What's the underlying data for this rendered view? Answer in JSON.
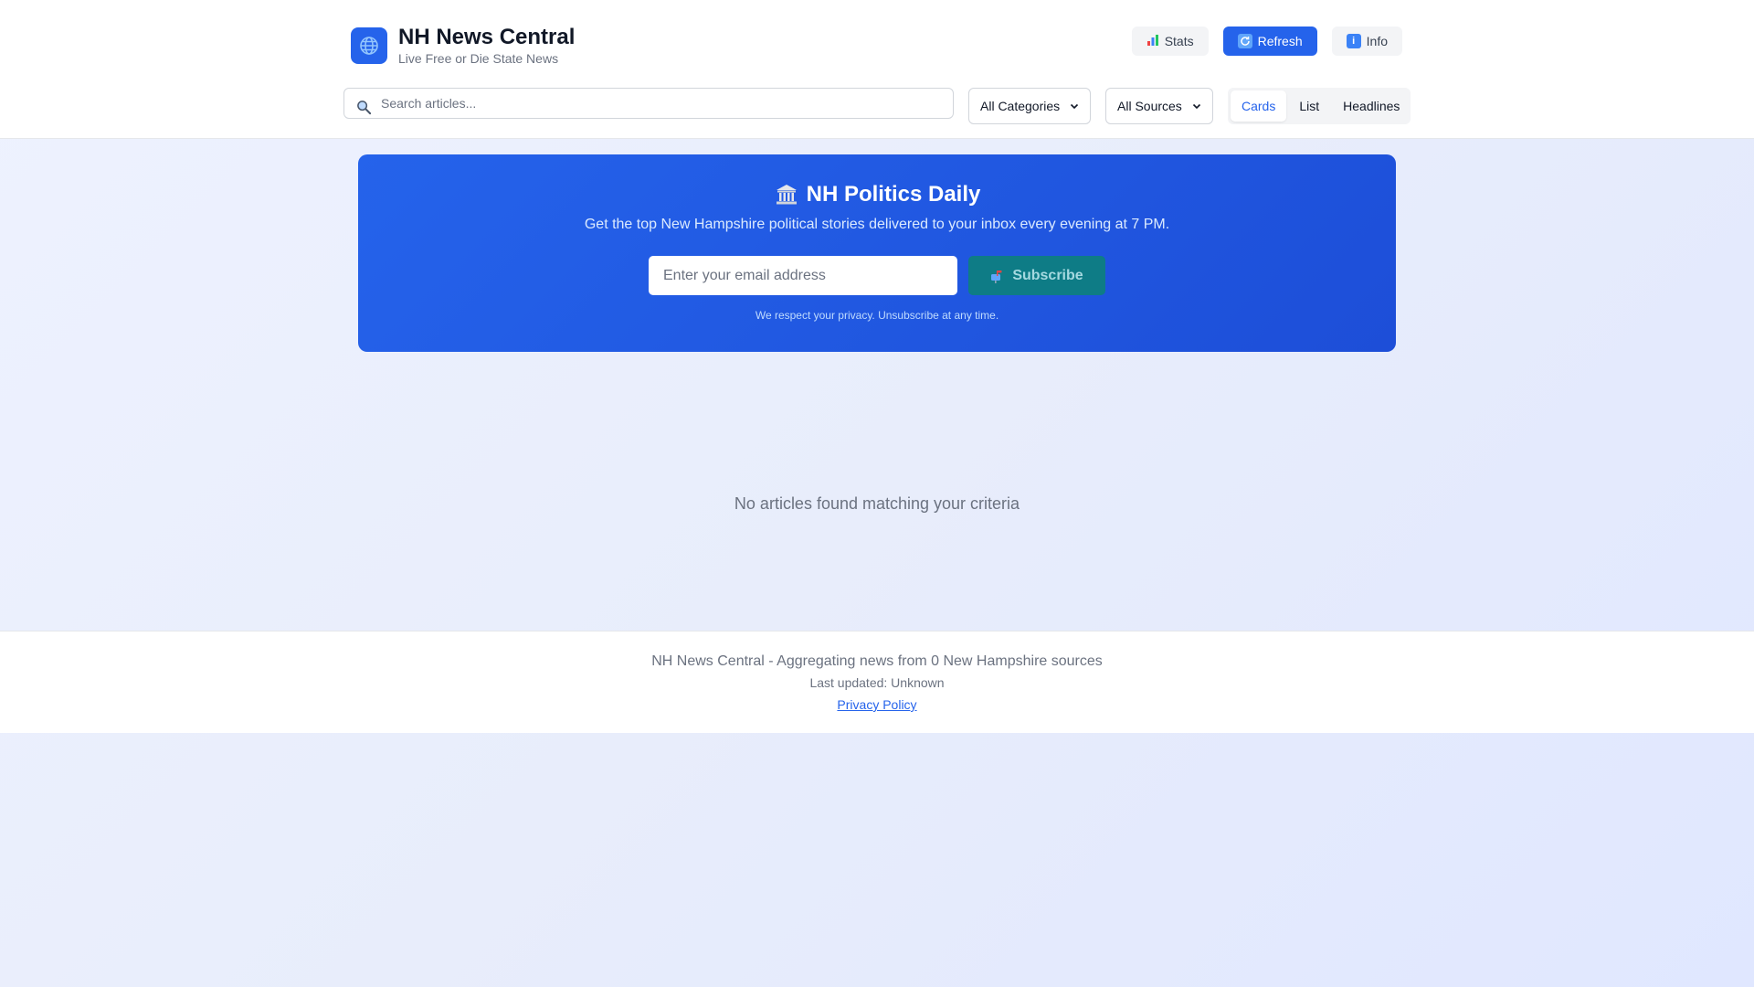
{
  "brand": {
    "title": "NH News Central",
    "tagline": "Live Free or Die State News",
    "logo_icon": "globe-icon"
  },
  "header_actions": [
    {
      "label": "Stats",
      "icon": "bar-chart-icon"
    },
    {
      "label": "Refresh",
      "icon": "refresh-icon"
    },
    {
      "label": "Info",
      "icon": "info-icon"
    }
  ],
  "search": {
    "placeholder": "Search articles...",
    "value": ""
  },
  "filters": {
    "category_selected": "All Categories",
    "source_selected": "All Sources"
  },
  "view_modes": [
    {
      "label": "Cards",
      "active": true
    },
    {
      "label": "List",
      "active": false
    },
    {
      "label": "Headlines",
      "active": false
    }
  ],
  "newsletter": {
    "title": "NH Politics Daily",
    "title_icon": "capitol-building-icon",
    "subtitle": "Get the top New Hampshire political stories delivered to your inbox every evening at 7 PM.",
    "email_placeholder": "Enter your email address",
    "subscribe_label": "Subscribe",
    "subscribe_icon": "mailbox-icon",
    "privacy_note": "We respect your privacy. Unsubscribe at any time."
  },
  "empty_state": {
    "message": "No articles found matching your criteria"
  },
  "footer": {
    "summary": "NH News Central - Aggregating news from 0 New Hampshire sources",
    "last_updated": "Last updated: Unknown",
    "privacy_link": "Privacy Policy"
  },
  "colors": {
    "primary": "#2563eb",
    "banner_start": "#2563eb",
    "banner_end": "#1d4ed8",
    "subscribe_button": "#0e7c86",
    "page_background": "#eef2ff"
  }
}
